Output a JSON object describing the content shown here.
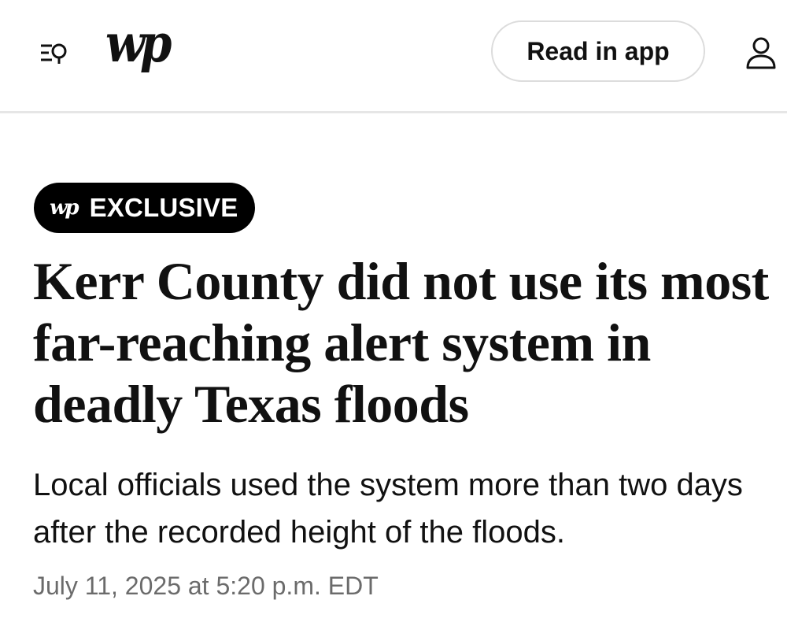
{
  "header": {
    "logo_text": "wp",
    "read_in_app_label": "Read in app",
    "icons": {
      "menu_search": "menu-search-icon",
      "account": "account-icon"
    }
  },
  "article": {
    "badge": {
      "logo_text": "wp",
      "label": "EXCLUSIVE"
    },
    "headline": "Kerr County did not use its most far-reaching alert system in deadly Texas floods",
    "subheadline": "Local officials used the system more than two days after the recorded height of the floods.",
    "timestamp": "July 11, 2025 at 5:20 p.m. EDT"
  },
  "colors": {
    "text": "#111111",
    "badge_background": "#000000",
    "timestamp": "#6b6b6b",
    "divider": "#e6e6e6",
    "button_border": "#dcdcdc"
  }
}
